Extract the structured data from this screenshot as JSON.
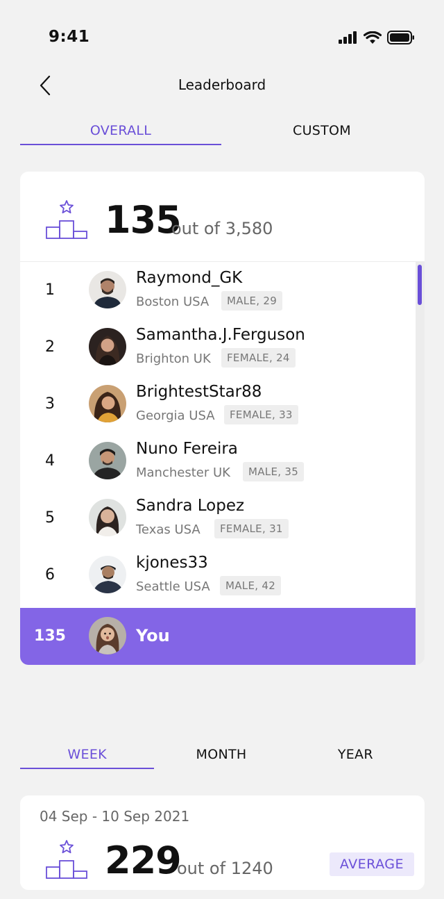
{
  "status": {
    "time": "9:41"
  },
  "nav": {
    "title": "Leaderboard"
  },
  "tabs": [
    {
      "label": "OVERALL",
      "active": true
    },
    {
      "label": "CUSTOM",
      "active": false
    }
  ],
  "summary": {
    "rank": "135",
    "total_text": "out of 3,580"
  },
  "leaders": [
    {
      "rank": "1",
      "name": "Raymond_GK",
      "location": "Boston USA",
      "tag": "MALE, 29"
    },
    {
      "rank": "2",
      "name": "Samantha.J.Ferguson",
      "location": "Brighton UK",
      "tag": "FEMALE, 24"
    },
    {
      "rank": "3",
      "name": "BrightestStar88",
      "location": "Georgia USA",
      "tag": "FEMALE, 33"
    },
    {
      "rank": "4",
      "name": "Nuno Fereira",
      "location": "Manchester UK",
      "tag": "MALE, 35"
    },
    {
      "rank": "5",
      "name": "Sandra Lopez",
      "location": "Texas USA",
      "tag": "FEMALE, 31"
    },
    {
      "rank": "6",
      "name": "kjones33",
      "location": "Seattle USA",
      "tag": "MALE, 42"
    }
  ],
  "you": {
    "rank": "135",
    "name": "You"
  },
  "period_tabs": [
    {
      "label": "WEEK",
      "active": true
    },
    {
      "label": "MONTH",
      "active": false
    },
    {
      "label": "YEAR",
      "active": false
    }
  ],
  "week": {
    "range": "04 Sep - 10 Sep 2021",
    "rank": "229",
    "total_text": "out of 1240",
    "badge": "AVERAGE"
  },
  "colors": {
    "accent": "#6a4fd8",
    "highlight_row": "#8365e6",
    "background": "#f2f2f2"
  },
  "icons": {
    "back": "chevron-left-icon",
    "podium": "podium-star-icon",
    "signal": "signal-icon",
    "wifi": "wifi-icon",
    "battery": "battery-icon"
  }
}
